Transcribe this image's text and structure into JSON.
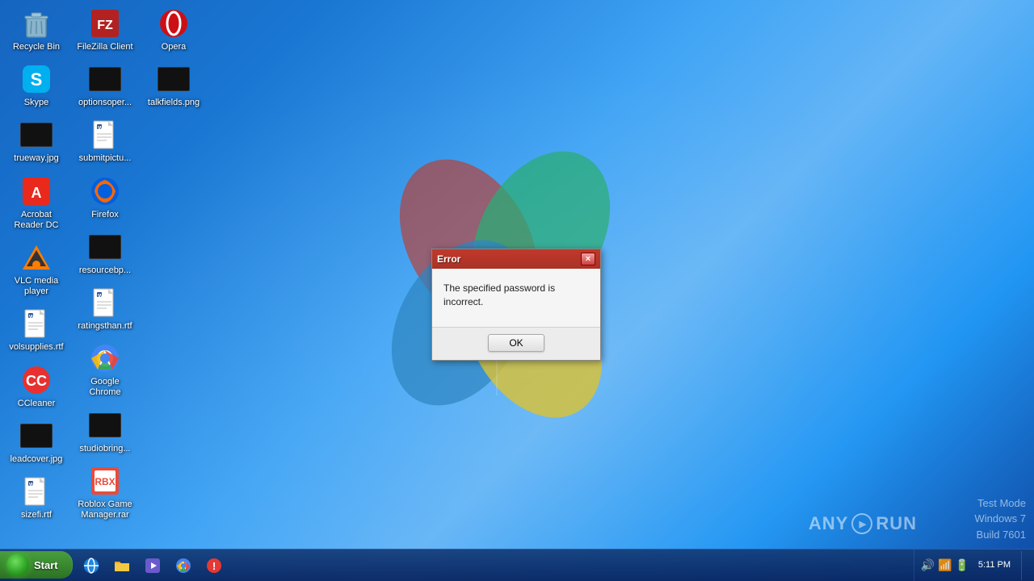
{
  "desktop": {
    "background_description": "Windows 7 blue gradient desktop"
  },
  "icons": [
    {
      "id": "recycle-bin",
      "label": "Recycle Bin",
      "type": "recycle"
    },
    {
      "id": "skype",
      "label": "Skype",
      "type": "skype"
    },
    {
      "id": "trueway-jpg",
      "label": "trueway.jpg",
      "type": "image-thumb"
    },
    {
      "id": "acrobat-reader",
      "label": "Acrobat Reader DC",
      "type": "acrobat"
    },
    {
      "id": "vlc-media-player",
      "label": "VLC media player",
      "type": "vlc"
    },
    {
      "id": "volsupplies-rtf",
      "label": "volsupplies.rtf",
      "type": "word"
    },
    {
      "id": "ccleaner",
      "label": "CCleaner",
      "type": "ccleaner"
    },
    {
      "id": "leadcover-jpg",
      "label": "leadcover.jpg",
      "type": "image-thumb"
    },
    {
      "id": "sizefi-rtf",
      "label": "sizefi.rtf",
      "type": "word"
    },
    {
      "id": "filezilla-client",
      "label": "FileZilla Client",
      "type": "filezilla"
    },
    {
      "id": "optionsoper",
      "label": "optionsoper...",
      "type": "image-thumb"
    },
    {
      "id": "submitpictu",
      "label": "submitpictu...",
      "type": "word"
    },
    {
      "id": "firefox",
      "label": "Firefox",
      "type": "firefox"
    },
    {
      "id": "resourcebp",
      "label": "resourcebp...",
      "type": "image-thumb"
    },
    {
      "id": "ratingsthan-rtf",
      "label": "ratingsthan.rtf",
      "type": "word"
    },
    {
      "id": "google-chrome",
      "label": "Google Chrome",
      "type": "chrome"
    },
    {
      "id": "studiobring",
      "label": "studiobring...",
      "type": "image-thumb"
    },
    {
      "id": "roblox-game-manager",
      "label": "Roblox Game Manager.rar",
      "type": "roblox"
    },
    {
      "id": "opera",
      "label": "Opera",
      "type": "opera"
    },
    {
      "id": "talkfields-png",
      "label": "talkfields.png",
      "type": "image-thumb"
    }
  ],
  "dialog": {
    "title": "Error",
    "message": "The specified password is incorrect.",
    "ok_button_label": "OK",
    "close_label": "×"
  },
  "taskbar": {
    "start_label": "Start",
    "clock_time": "5:11 PM",
    "watermark_line1": "Test Mode",
    "watermark_line2": "Windows 7",
    "watermark_line3": "Build 7601"
  },
  "anyrun": {
    "text": "ANY▶RUN"
  }
}
